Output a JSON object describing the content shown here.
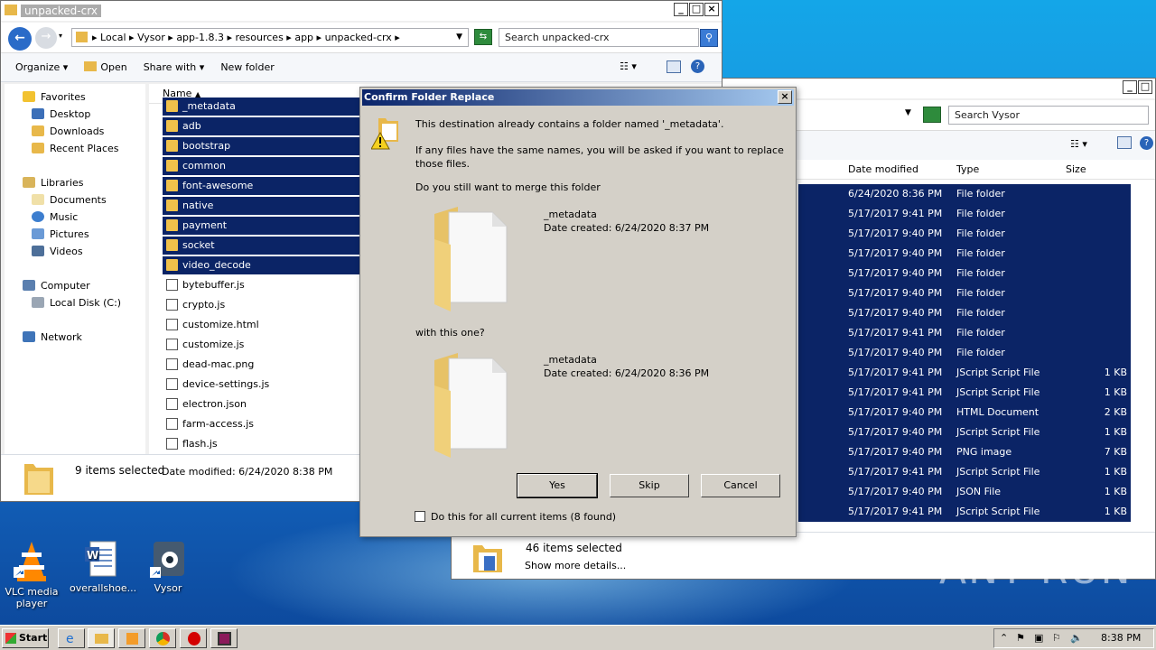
{
  "left_window": {
    "title": "unpacked-crx",
    "breadcrumb": [
      "Local",
      "Vysor",
      "app-1.8.3",
      "resources",
      "app",
      "unpacked-crx"
    ],
    "search_placeholder": "Search unpacked-crx",
    "toolbar": {
      "organize": "Organize",
      "open": "Open",
      "share_with": "Share with",
      "new_folder": "New folder"
    },
    "column_name": "Name",
    "nav": {
      "favorites": "Favorites",
      "desktop": "Desktop",
      "downloads": "Downloads",
      "recent": "Recent Places",
      "libraries": "Libraries",
      "documents": "Documents",
      "music": "Music",
      "pictures": "Pictures",
      "videos": "Videos",
      "computer": "Computer",
      "local_disk": "Local Disk (C:)",
      "network": "Network"
    },
    "files": [
      {
        "name": "_metadata",
        "kind": "folder",
        "selected": true
      },
      {
        "name": "adb",
        "kind": "folder",
        "selected": true
      },
      {
        "name": "bootstrap",
        "kind": "folder",
        "selected": true
      },
      {
        "name": "common",
        "kind": "folder",
        "selected": true
      },
      {
        "name": "font-awesome",
        "kind": "folder",
        "selected": true
      },
      {
        "name": "native",
        "kind": "folder",
        "selected": true
      },
      {
        "name": "payment",
        "kind": "folder",
        "selected": true
      },
      {
        "name": "socket",
        "kind": "folder",
        "selected": true
      },
      {
        "name": "video_decode",
        "kind": "folder",
        "selected": true
      },
      {
        "name": "bytebuffer.js",
        "kind": "js",
        "selected": false
      },
      {
        "name": "crypto.js",
        "kind": "js",
        "selected": false
      },
      {
        "name": "customize.html",
        "kind": "html",
        "selected": false
      },
      {
        "name": "customize.js",
        "kind": "js",
        "selected": false
      },
      {
        "name": "dead-mac.png",
        "kind": "png",
        "selected": false
      },
      {
        "name": "device-settings.js",
        "kind": "js",
        "selected": false
      },
      {
        "name": "electron.json",
        "kind": "json",
        "selected": false
      },
      {
        "name": "farm-access.js",
        "kind": "js",
        "selected": false
      },
      {
        "name": "flash.js",
        "kind": "js",
        "selected": false
      }
    ],
    "status_count": "9 items selected",
    "status_modified": "Date modified: 6/24/2020 8:38 PM"
  },
  "right_window": {
    "search_placeholder": "Search Vysor",
    "columns": {
      "date": "Date modified",
      "type": "Type",
      "size": "Size"
    },
    "rows": [
      {
        "date": "6/24/2020 8:36 PM",
        "type": "File folder",
        "size": ""
      },
      {
        "date": "5/17/2017 9:41 PM",
        "type": "File folder",
        "size": ""
      },
      {
        "date": "5/17/2017 9:40 PM",
        "type": "File folder",
        "size": ""
      },
      {
        "date": "5/17/2017 9:40 PM",
        "type": "File folder",
        "size": ""
      },
      {
        "date": "5/17/2017 9:40 PM",
        "type": "File folder",
        "size": ""
      },
      {
        "date": "5/17/2017 9:40 PM",
        "type": "File folder",
        "size": ""
      },
      {
        "date": "5/17/2017 9:40 PM",
        "type": "File folder",
        "size": ""
      },
      {
        "date": "5/17/2017 9:41 PM",
        "type": "File folder",
        "size": ""
      },
      {
        "date": "5/17/2017 9:40 PM",
        "type": "File folder",
        "size": ""
      },
      {
        "date": "5/17/2017 9:41 PM",
        "type": "JScript Script File",
        "size": "1 KB"
      },
      {
        "date": "5/17/2017 9:41 PM",
        "type": "JScript Script File",
        "size": "1 KB"
      },
      {
        "date": "5/17/2017 9:40 PM",
        "type": "HTML Document",
        "size": "2 KB"
      },
      {
        "date": "5/17/2017 9:40 PM",
        "type": "JScript Script File",
        "size": "1 KB"
      },
      {
        "date": "5/17/2017 9:40 PM",
        "type": "PNG image",
        "size": "7 KB"
      },
      {
        "date": "5/17/2017 9:41 PM",
        "type": "JScript Script File",
        "size": "1 KB"
      },
      {
        "date": "5/17/2017 9:40 PM",
        "type": "JSON File",
        "size": "1 KB"
      },
      {
        "date": "5/17/2017 9:41 PM",
        "type": "JScript Script File",
        "size": "1 KB"
      }
    ],
    "status_count": "46 items selected",
    "status_more": "Show more details..."
  },
  "dialog": {
    "title": "Confirm Folder Replace",
    "line1": "This destination already contains a folder named '_metadata'.",
    "line2a": "If any files have the same names, you will be asked if you want to replace",
    "line2b": "those files.",
    "question": "Do you still want to merge this folder",
    "existing_name": "_metadata",
    "existing_date": "Date created: 6/24/2020 8:37 PM",
    "with_text": "with this one?",
    "new_name": "_metadata",
    "new_date": "Date created: 6/24/2020 8:36 PM",
    "yes": "Yes",
    "skip": "Skip",
    "cancel": "Cancel",
    "checkbox_label": "Do this for all current items (8 found)"
  },
  "desktop_icons": [
    {
      "label_line1": "VLC media",
      "label_line2": "player"
    },
    {
      "label_line1": "overallshoe...",
      "label_line2": ""
    },
    {
      "label_line1": "Vysor",
      "label_line2": ""
    }
  ],
  "taskbar": {
    "start": "Start",
    "clock": "8:38 PM"
  },
  "watermark": "ANY RUN"
}
